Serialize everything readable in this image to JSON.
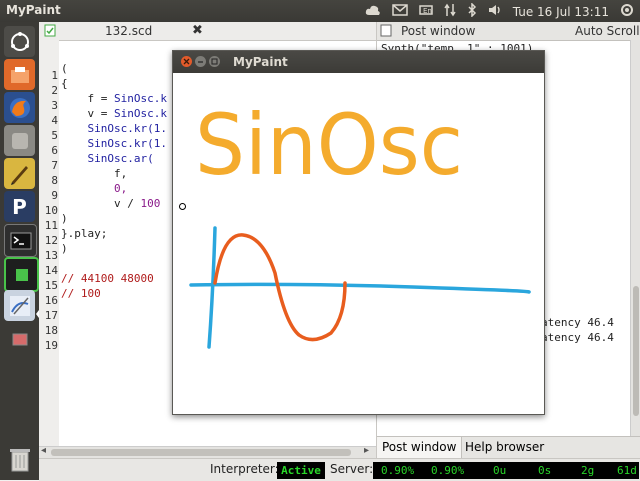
{
  "topbar": {
    "app_name": "MyPaint",
    "clock": "Tue 16 Jul 13:11"
  },
  "launcher": {
    "items": [
      {
        "icon": "ubuntu-home-icon"
      },
      {
        "icon": "files-icon"
      },
      {
        "icon": "firefox-icon"
      },
      {
        "icon": "app-icon"
      },
      {
        "icon": "text-editor-icon"
      },
      {
        "icon": "pidgin-icon",
        "glyph": "P"
      },
      {
        "icon": "terminal-icon"
      },
      {
        "icon": "monitor-icon"
      },
      {
        "icon": "mypaint-icon"
      },
      {
        "icon": "trash-icon"
      }
    ]
  },
  "editor": {
    "tab_title": "132.scd",
    "lines": [
      "1",
      "2",
      "3",
      "4",
      "5",
      "6",
      "7",
      "8",
      "9",
      "10",
      "11",
      "12",
      "13",
      "14",
      "15",
      "16",
      "17",
      "18",
      "19"
    ],
    "code": {
      "l2": "(",
      "l3": "{",
      "l4a": "    f = ",
      "l4b": "SinOsc.k",
      "l5a": "    v = ",
      "l5b": "SinOsc.k",
      "l6": "    SinOsc.kr(1.",
      "l7": "    SinOsc.kr(1.",
      "l8": "    SinOsc.ar(",
      "l9": "        f,",
      "l10a": "        ",
      "l10b": "0,",
      "l11a": "        v / ",
      "l11b": "100",
      "l12": ")",
      "l13": "}.play;",
      "l14": ")",
      "l16": "// 44100 48000",
      "l17": "// 100"
    }
  },
  "post_window": {
    "title": "Post window",
    "auto_scroll": "Auto Scroll",
    "line1": "Synth(\"temp__1\" : 1001)",
    "latency1": "atency 46.4",
    "latency2": "atency 46.4",
    "tab_post": "Post window",
    "tab_help": "Help browser"
  },
  "status": {
    "interpreter_label": "Interpreter:",
    "interpreter_value": "Active",
    "server_label": "Server:",
    "cpu_avg": "0.90%",
    "cpu_peak": "0.90%",
    "ugens": "0u",
    "synths": "0s",
    "groups": "2g",
    "defs": "61d"
  },
  "mypaint": {
    "title": "MyPaint",
    "canvas_text": "SinOsc",
    "colors": {
      "text": "#f4ab2d",
      "axes": "#2aa6dd",
      "wave": "#e85d1e"
    }
  }
}
